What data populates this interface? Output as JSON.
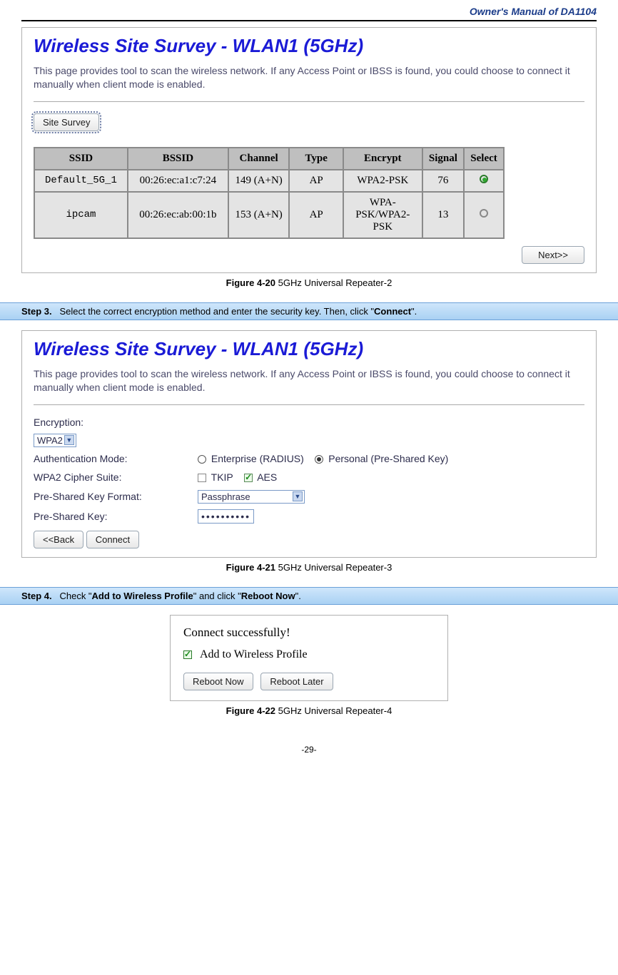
{
  "header": {
    "manual_title": "Owner's Manual of DA1104"
  },
  "panel1": {
    "title": "Wireless Site Survey - WLAN1 (5GHz)",
    "desc": "This page provides tool to scan the wireless network. If any Access Point or IBSS is found, you could choose to connect it manually when client mode is enabled.",
    "site_survey_btn": "Site Survey",
    "next_btn": "Next>>",
    "columns": [
      "SSID",
      "BSSID",
      "Channel",
      "Type",
      "Encrypt",
      "Signal",
      "Select"
    ],
    "rows": [
      {
        "ssid": "Default_5G_1",
        "bssid": "00:26:ec:a1:c7:24",
        "channel": "149 (A+N)",
        "type": "AP",
        "encrypt": "WPA2-PSK",
        "signal": "76",
        "selected": true
      },
      {
        "ssid": "ipcam",
        "bssid": "00:26:ec:ab:00:1b",
        "channel": "153 (A+N)",
        "type": "AP",
        "encrypt": "WPA-PSK/WPA2-PSK",
        "signal": "13",
        "selected": false
      }
    ]
  },
  "fig20": {
    "label": "Figure 4-20",
    "text": "5GHz Universal Repeater-2"
  },
  "step3": {
    "label": "Step 3.",
    "text_before": "Select the correct encryption method and enter the security key. Then, click \"",
    "bold": "Connect",
    "text_after": "\"."
  },
  "panel2": {
    "title": "Wireless Site Survey - WLAN1 (5GHz)",
    "desc": "This page provides tool to scan the wireless network. If any Access Point or IBSS is found, you could choose to connect it manually when client mode is enabled.",
    "encryption_label": "Encryption:",
    "encryption_value": "WPA2",
    "auth_label": "Authentication Mode:",
    "auth_opt1": "Enterprise (RADIUS)",
    "auth_opt2": "Personal (Pre-Shared Key)",
    "cipher_label": "WPA2 Cipher Suite:",
    "cipher_opt1": "TKIP",
    "cipher_opt2": "AES",
    "pskfmt_label": "Pre-Shared Key Format:",
    "pskfmt_value": "Passphrase",
    "psk_label": "Pre-Shared Key:",
    "psk_value": "••••••••••",
    "back_btn": "<<Back",
    "connect_btn": "Connect"
  },
  "fig21": {
    "label": "Figure 4-21",
    "text": "5GHz Universal Repeater-3"
  },
  "step4": {
    "label": "Step 4.",
    "t1": "Check \"",
    "b1": "Add to Wireless Profile",
    "t2": "\" and click \"",
    "b2": "Reboot Now",
    "t3": "\"."
  },
  "panel3": {
    "msg": "Connect successfully!",
    "add_label": "Add to Wireless Profile",
    "reboot_now": "Reboot Now",
    "reboot_later": "Reboot Later"
  },
  "fig22": {
    "label": "Figure 4-22",
    "text": "5GHz Universal Repeater-4"
  },
  "footer": {
    "page": "-29-"
  }
}
